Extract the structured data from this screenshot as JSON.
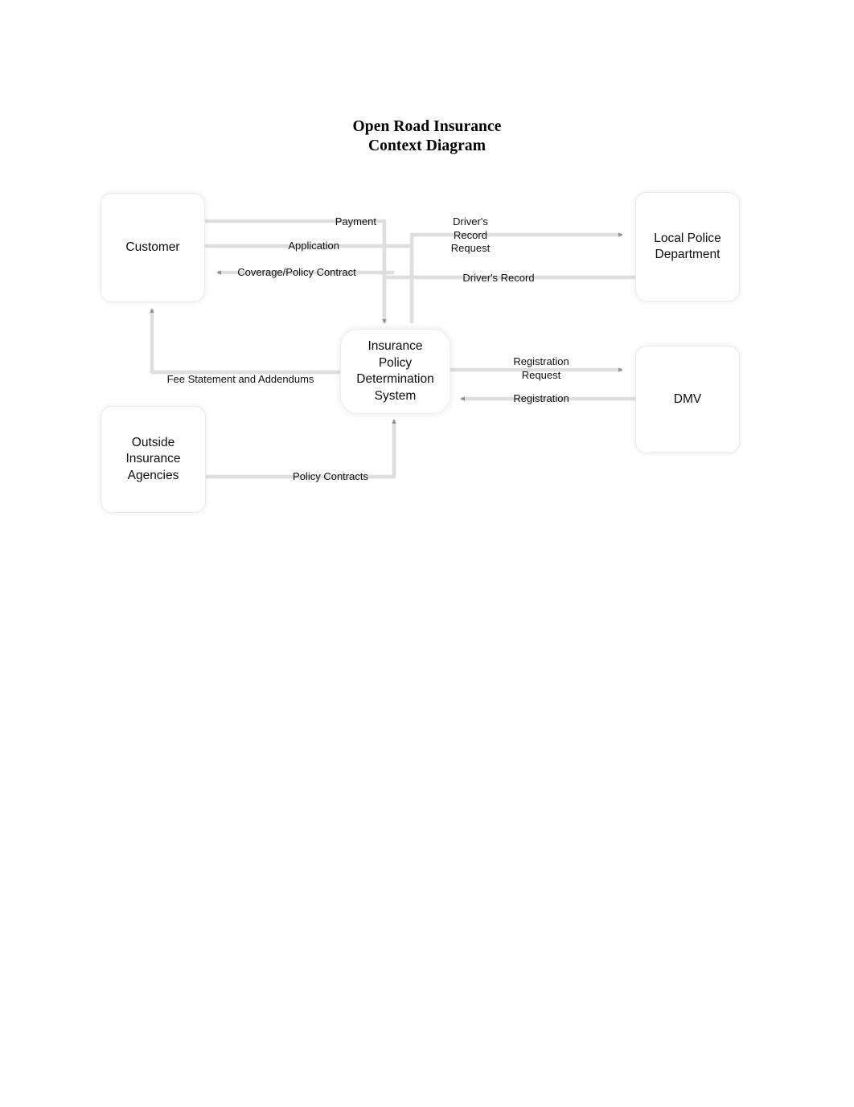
{
  "document": {
    "title_line1": "Open Road Insurance",
    "title_line2": "Context Diagram"
  },
  "diagram": {
    "type": "context-diagram",
    "process": {
      "id": "insurance-policy-determination-system",
      "label": "Insurance\nPolicy\nDetermination\nSystem"
    },
    "entities": [
      {
        "id": "customer",
        "label": "Customer"
      },
      {
        "id": "local-police-department",
        "label": "Local Police\nDepartment"
      },
      {
        "id": "dmv",
        "label": "DMV"
      },
      {
        "id": "outside-insurance-agencies",
        "label": "Outside\nInsurance\nAgencies"
      }
    ],
    "flows": [
      {
        "id": "payment",
        "label": "Payment",
        "from": "customer",
        "to": "insurance-policy-determination-system"
      },
      {
        "id": "application",
        "label": "Application",
        "from": "customer",
        "to": "insurance-policy-determination-system"
      },
      {
        "id": "coverage-policy-contract",
        "label": "Coverage/Policy Contract",
        "from": "insurance-policy-determination-system",
        "to": "customer"
      },
      {
        "id": "fee-statement-and-addendums",
        "label": "Fee Statement and Addendums",
        "from": "insurance-policy-determination-system",
        "to": "customer"
      },
      {
        "id": "drivers-record-request",
        "label": "Driver's\nRecord\nRequest",
        "from": "insurance-policy-determination-system",
        "to": "local-police-department"
      },
      {
        "id": "drivers-record",
        "label": "Driver's Record",
        "from": "local-police-department",
        "to": "insurance-policy-determination-system"
      },
      {
        "id": "registration-request",
        "label": "Registration\nRequest",
        "from": "insurance-policy-determination-system",
        "to": "dmv"
      },
      {
        "id": "registration",
        "label": "Registration",
        "from": "dmv",
        "to": "insurance-policy-determination-system"
      },
      {
        "id": "policy-contracts",
        "label": "Policy Contracts",
        "from": "outside-insurance-agencies",
        "to": "insurance-policy-determination-system"
      }
    ]
  },
  "colors": {
    "page_background": "#ffffff",
    "text": "#111111",
    "box_border": "#e9e9e9",
    "connector": "#dcdcdc",
    "arrowhead": "#8a8a8a"
  }
}
